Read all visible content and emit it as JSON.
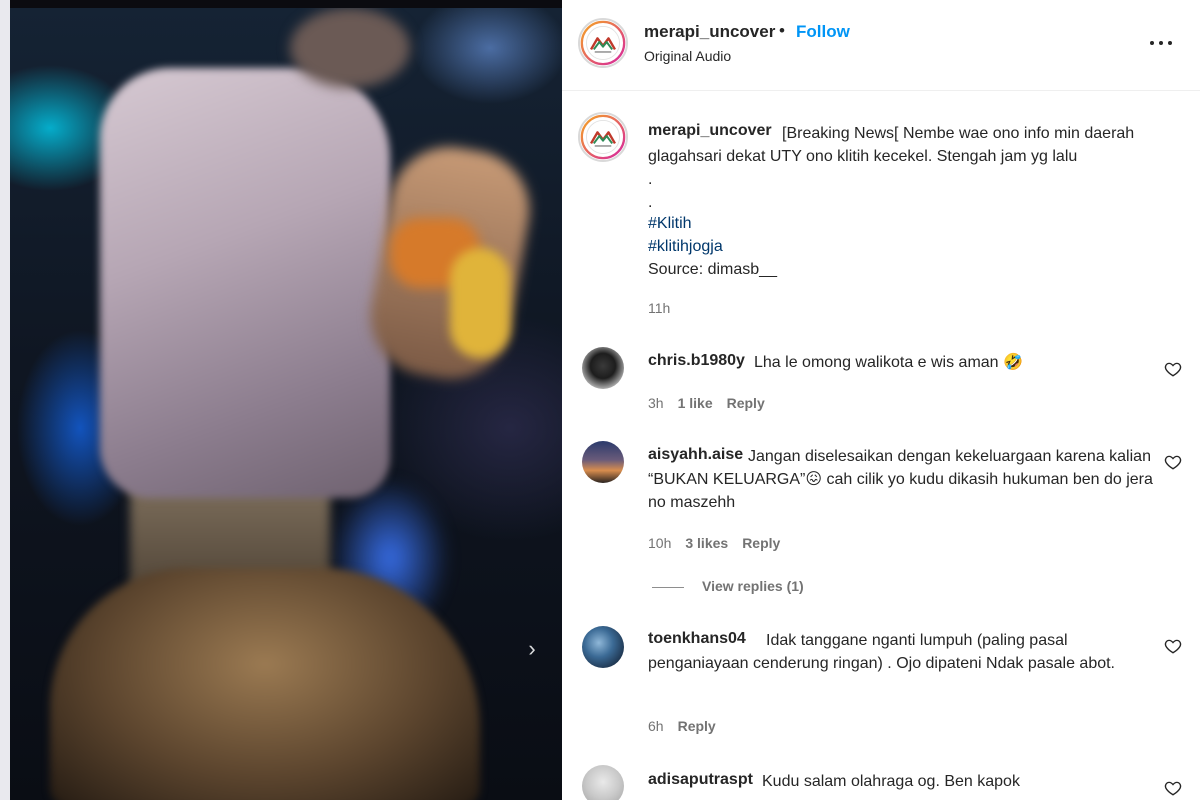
{
  "post": {
    "username": "merapi_uncover",
    "separator": "•",
    "follow_label": "Follow",
    "audio_label": "Original Audio",
    "avatar_icon": "merapi-uncover-logo-icon",
    "accent_color": "#0095f6"
  },
  "caption": {
    "username": "merapi_uncover",
    "text": "[Breaking News[ Nembe wae ono info min daerah glagahsari dekat UTY ono klitih kecekel. Stengah jam yg lalu",
    "dot1": ".",
    "dot2": ".",
    "hashtags": [
      "#Klitih",
      "#klitihjogja"
    ],
    "source": "Source: dimasb__",
    "time": "11h"
  },
  "comments": [
    {
      "username": "chris.b1980y",
      "text": "Lha le omong walikota e wis aman 🤣",
      "time": "3h",
      "likes": "1 like",
      "reply_label": "Reply"
    },
    {
      "username": "aisyahh.aise",
      "text": "Jangan diselesaikan dengan kekeluargaan karena kalian “BUKAN KELUARGA”😖  cah cilik yo kudu dikasih hukuman ben do jera no maszehh",
      "time": "10h",
      "likes": "3 likes",
      "reply_label": "Reply",
      "view_replies": "View replies (1)"
    },
    {
      "username": "toenkhans04",
      "text": "Idak tanggane nganti lumpuh (paling pasal penganiayaan cenderung ringan) . Ojo dipateni Ndak pasale abot.",
      "time": "6h",
      "reply_label": "Reply"
    },
    {
      "username": "adisaputraspt",
      "text": "Kudu salam olahraga og. Ben kapok"
    }
  ],
  "media": {
    "next_icon": "chevron-right-icon",
    "next_glyph": "›"
  }
}
